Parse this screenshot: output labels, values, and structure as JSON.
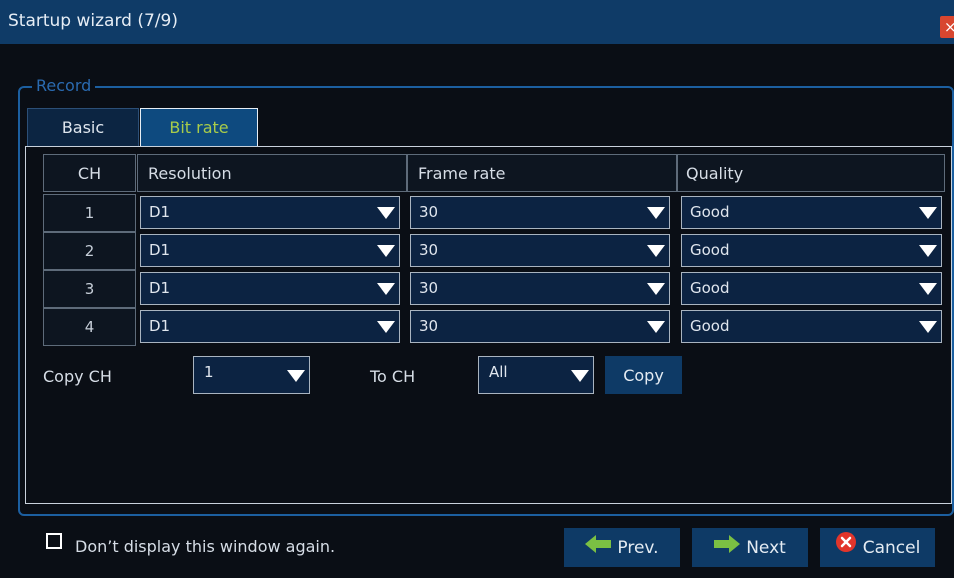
{
  "window": {
    "title": "Startup wizard (7/9)",
    "close_glyph": "×"
  },
  "group": {
    "legend": "Record"
  },
  "tabs": [
    {
      "label": "Basic",
      "active": false
    },
    {
      "label": "Bit rate",
      "active": true
    }
  ],
  "table": {
    "headers": [
      "CH",
      "Resolution",
      "Frame rate",
      "Quality"
    ],
    "rows": [
      {
        "ch": "1",
        "resolution": "D1",
        "frame_rate": "30",
        "quality": "Good"
      },
      {
        "ch": "2",
        "resolution": "D1",
        "frame_rate": "30",
        "quality": "Good"
      },
      {
        "ch": "3",
        "resolution": "D1",
        "frame_rate": "30",
        "quality": "Good"
      },
      {
        "ch": "4",
        "resolution": "D1",
        "frame_rate": "30",
        "quality": "Good"
      }
    ]
  },
  "copy": {
    "label": "Copy CH",
    "from_value": "1",
    "to_label": "To CH",
    "to_value": "All",
    "button": "Copy"
  },
  "footer": {
    "checkbox_label": "Don’t display this window again.",
    "checked": false,
    "prev": "Prev.",
    "next": "Next",
    "cancel": "Cancel"
  },
  "colors": {
    "accent": "#0e3a66",
    "title_bar": "#0f3b67",
    "active_tab_text": "#a8cc4a",
    "prev_icon": "#7bc043",
    "next_icon": "#7bc043",
    "cancel_icon": "#e2352b"
  },
  "icons": {
    "prev": "arrow-left-icon",
    "next": "arrow-right-icon",
    "cancel": "cancel-x-icon",
    "dropdown": "triangle-down-icon"
  }
}
